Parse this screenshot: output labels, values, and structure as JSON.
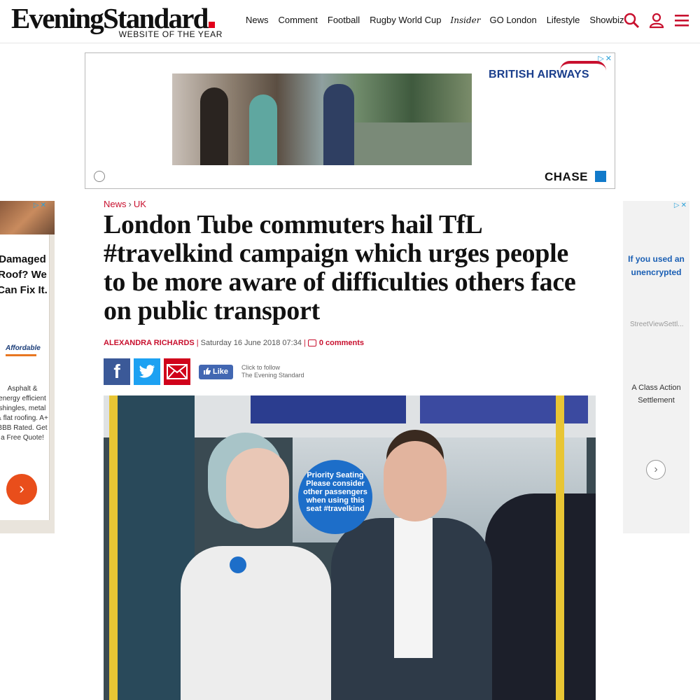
{
  "header": {
    "logo": "EveningStandard",
    "tagline": "WEBSITE OF THE YEAR",
    "nav": [
      "News",
      "Comment",
      "Football",
      "Rugby World Cup",
      "Insider",
      "GO London",
      "Lifestyle",
      "Showbiz"
    ],
    "icons": [
      "search-icon",
      "user-icon",
      "menu-icon"
    ]
  },
  "top_ad": {
    "brand1": "BRITISH AIRWAYS",
    "brand2": "CHASE"
  },
  "left_ad": {
    "headline": "Damaged Roof? We Can Fix It.",
    "logo": "Affordable",
    "body": "Asphalt & energy efficient shingles, metal & flat roofing. A+ BBB Rated. Get a Free Quote!"
  },
  "right_ad": {
    "headline": "If you used an unencrypted",
    "url": "StreetViewSettl...",
    "body": "A Class Action Settlement"
  },
  "article": {
    "breadcrumb": [
      "News",
      "UK"
    ],
    "headline": "London Tube commuters hail TfL #travelkind campaign which urges people to be more aware of difficulties others face on public transport",
    "author": "ALEXANDRA RICHARDS",
    "date": "Saturday 16 June 2018 07:34",
    "comments": "0 comments",
    "like_label": "Like",
    "follow_text": [
      "Click to follow",
      "The Evening Standard"
    ],
    "photo_sign": "Priority Seating Please consider other passengers when using this seat #travelkind"
  },
  "colors": {
    "accent": "#c8102e",
    "facebook": "#3b5998",
    "twitter": "#1da1f2",
    "email": "#d0021b"
  }
}
